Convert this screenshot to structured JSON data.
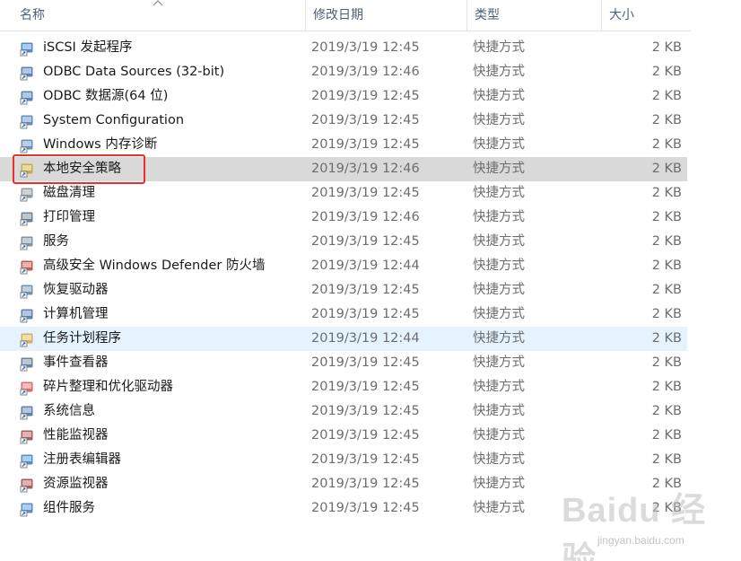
{
  "header": {
    "name": "名称",
    "date": "修改日期",
    "type": "类型",
    "size": "大小"
  },
  "rows": [
    {
      "name": "iSCSI 发起程序",
      "date": "2019/3/19 12:45",
      "type": "快捷方式",
      "size": "2 KB",
      "icon": "iscsi-icon",
      "color": "#2b79c2"
    },
    {
      "name": "ODBC Data Sources (32-bit)",
      "date": "2019/3/19 12:46",
      "type": "快捷方式",
      "size": "2 KB",
      "icon": "odbc-icon",
      "color": "#3a6fb0"
    },
    {
      "name": "ODBC 数据源(64 位)",
      "date": "2019/3/19 12:45",
      "type": "快捷方式",
      "size": "2 KB",
      "icon": "odbc-icon",
      "color": "#3a6fb0"
    },
    {
      "name": "System Configuration",
      "date": "2019/3/19 12:45",
      "type": "快捷方式",
      "size": "2 KB",
      "icon": "system-config-icon",
      "color": "#4a7ab5"
    },
    {
      "name": "Windows 内存诊断",
      "date": "2019/3/19 12:45",
      "type": "快捷方式",
      "size": "2 KB",
      "icon": "memory-diagnostic-icon",
      "color": "#4d7bb8"
    },
    {
      "name": "本地安全策略",
      "date": "2019/3/19 12:46",
      "type": "快捷方式",
      "size": "2 KB",
      "icon": "security-policy-icon",
      "color": "#c9a227"
    },
    {
      "name": "磁盘清理",
      "date": "2019/3/19 12:45",
      "type": "快捷方式",
      "size": "2 KB",
      "icon": "disk-cleanup-icon",
      "color": "#7d8a96"
    },
    {
      "name": "打印管理",
      "date": "2019/3/19 12:46",
      "type": "快捷方式",
      "size": "2 KB",
      "icon": "printer-icon",
      "color": "#5a6b7c"
    },
    {
      "name": "服务",
      "date": "2019/3/19 12:45",
      "type": "快捷方式",
      "size": "2 KB",
      "icon": "services-gear-icon",
      "color": "#6f7f8f"
    },
    {
      "name": "高级安全 Windows Defender 防火墙",
      "date": "2019/3/19 12:44",
      "type": "快捷方式",
      "size": "2 KB",
      "icon": "firewall-icon",
      "color": "#c0392b"
    },
    {
      "name": "恢复驱动器",
      "date": "2019/3/19 12:45",
      "type": "快捷方式",
      "size": "2 KB",
      "icon": "recovery-drive-icon",
      "color": "#5b7fa6"
    },
    {
      "name": "计算机管理",
      "date": "2019/3/19 12:45",
      "type": "快捷方式",
      "size": "2 KB",
      "icon": "computer-management-icon",
      "color": "#3d6ea8"
    },
    {
      "name": "任务计划程序",
      "date": "2019/3/19 12:44",
      "type": "快捷方式",
      "size": "2 KB",
      "icon": "task-scheduler-clock-icon",
      "color": "#d9a43a"
    },
    {
      "name": "事件查看器",
      "date": "2019/3/19 12:45",
      "type": "快捷方式",
      "size": "2 KB",
      "icon": "event-viewer-icon",
      "color": "#4f6f8f"
    },
    {
      "name": "碎片整理和优化驱动器",
      "date": "2019/3/19 12:45",
      "type": "快捷方式",
      "size": "2 KB",
      "icon": "defrag-icon",
      "color": "#d35454"
    },
    {
      "name": "系统信息",
      "date": "2019/3/19 12:45",
      "type": "快捷方式",
      "size": "2 KB",
      "icon": "system-info-icon",
      "color": "#3e6ca5"
    },
    {
      "name": "性能监视器",
      "date": "2019/3/19 12:45",
      "type": "快捷方式",
      "size": "2 KB",
      "icon": "performance-gauge-icon",
      "color": "#a04040"
    },
    {
      "name": "注册表编辑器",
      "date": "2019/3/19 12:45",
      "type": "快捷方式",
      "size": "2 KB",
      "icon": "registry-editor-icon",
      "color": "#2f7cc4"
    },
    {
      "name": "资源监视器",
      "date": "2019/3/19 12:45",
      "type": "快捷方式",
      "size": "2 KB",
      "icon": "resource-monitor-icon",
      "color": "#a04040"
    },
    {
      "name": "组件服务",
      "date": "2019/3/19 12:45",
      "type": "快捷方式",
      "size": "2 KB",
      "icon": "component-services-icon",
      "color": "#3a7cc0"
    }
  ],
  "watermark": {
    "brand": "Baidu 经验",
    "url": "jingyan.baidu.com"
  }
}
